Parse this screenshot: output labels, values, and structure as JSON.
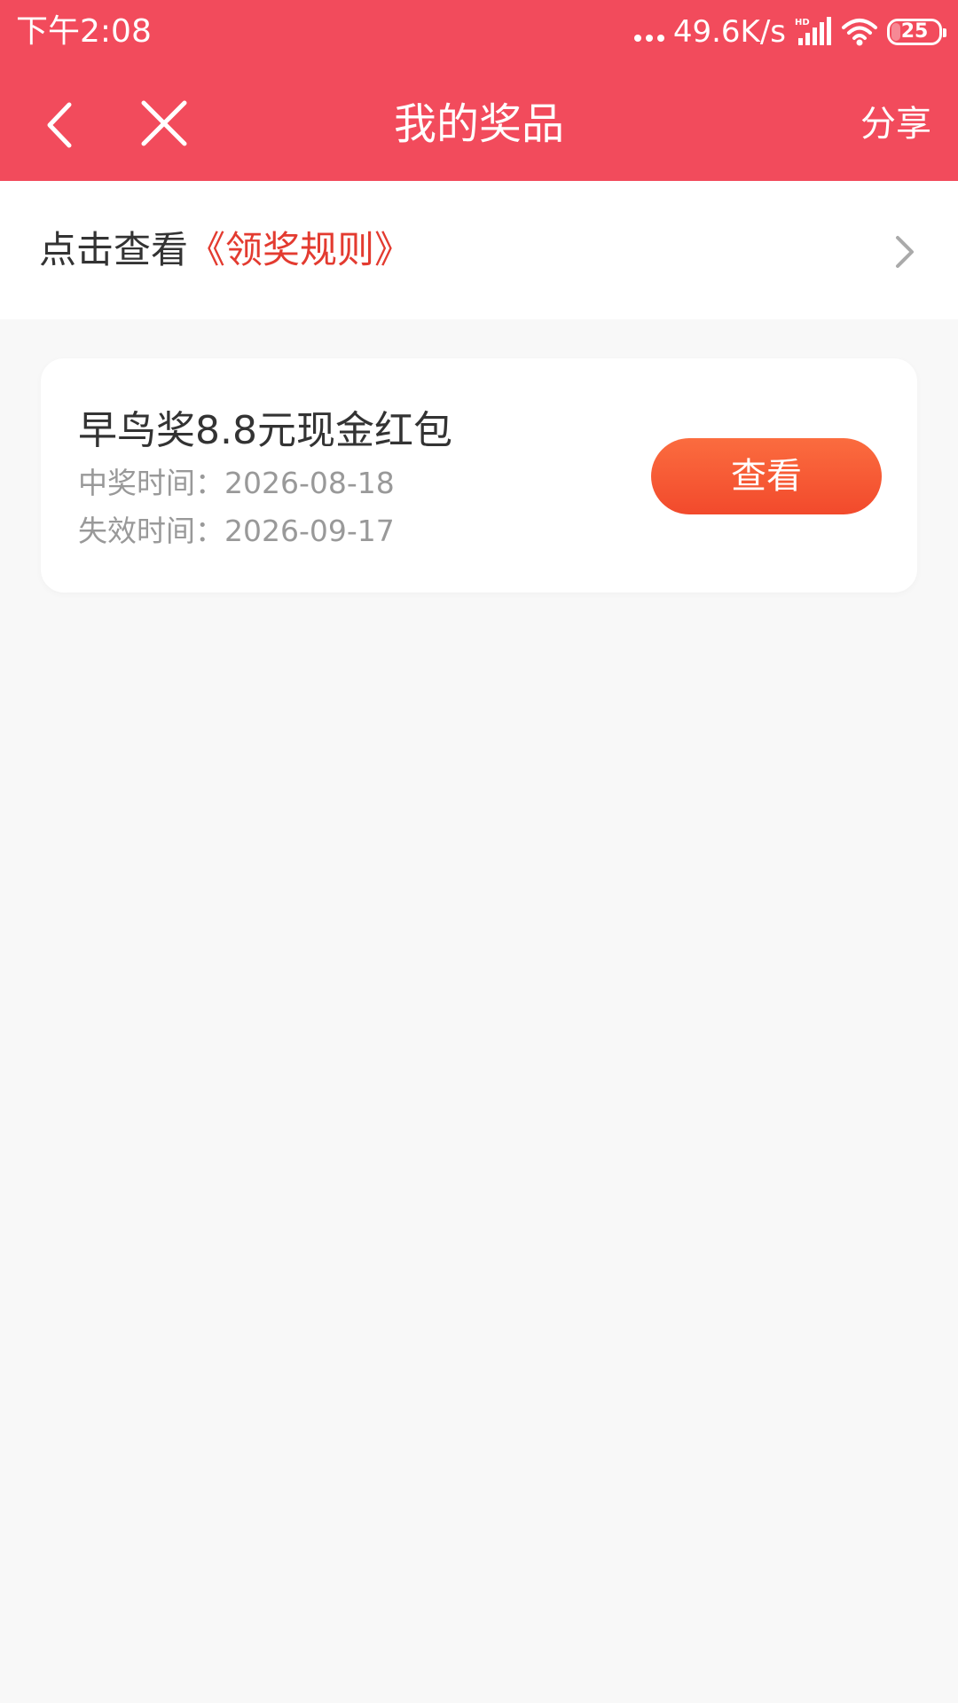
{
  "status_bar": {
    "time": "下午2:08",
    "net_speed": "49.6K/s",
    "battery": "25",
    "battery_level_percent": 25
  },
  "header": {
    "title": "我的奖品",
    "share_label": "分享"
  },
  "rules": {
    "prefix": "点击查看",
    "link": "《领奖规则》"
  },
  "prizes": [
    {
      "name": "早鸟奖8.8元现金红包",
      "win_time": "中奖时间：2026-08-18",
      "expire_time": "失效时间：2026-09-17",
      "button_label": "查看"
    }
  ],
  "colors": {
    "header_bg": "#f24b5c",
    "link": "#e33b30",
    "button_top": "#fb6c3f",
    "button_bottom": "#f24a2c",
    "page_bg": "#f8f8f8"
  },
  "icons": [
    "back-arrow-icon",
    "close-icon",
    "chevron-right-icon",
    "signal-icon",
    "wifi-icon",
    "battery-icon"
  ]
}
